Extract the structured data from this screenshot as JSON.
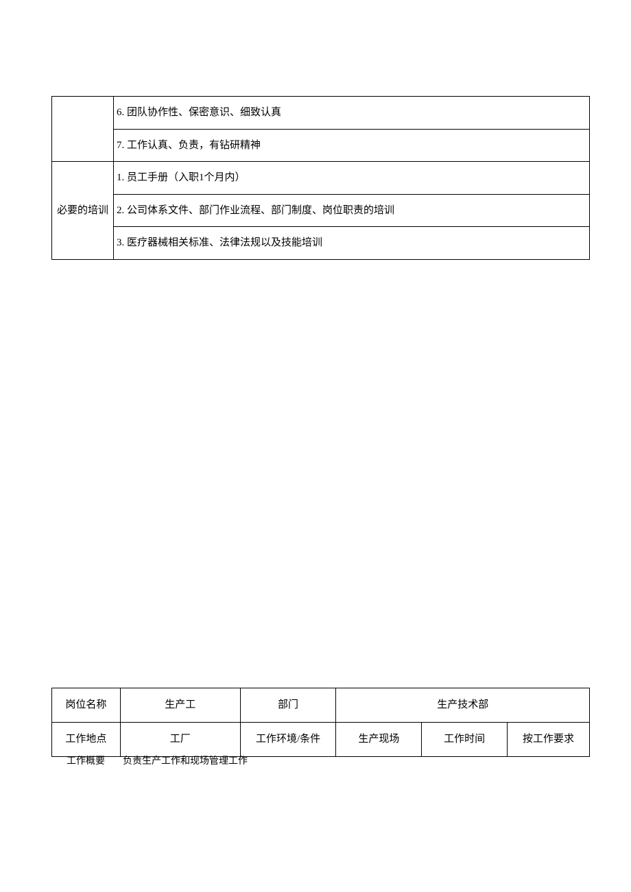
{
  "table1": {
    "section1_row1": "6. 团队协作性、保密意识、细致认真",
    "section1_row2": "7. 工作认真、负责，有钻研精神",
    "section2_label": "必要的培训",
    "section2_row1": "1. 员工手册（入职1个月内）",
    "section2_row2": "2. 公司体系文件、部门作业流程、部门制度、岗位职责的培训",
    "section2_row3": "3. 医疗器械相关标准、法律法规以及技能培训"
  },
  "table2": {
    "row1": {
      "label": "岗位名称",
      "value1": "生产工",
      "label2": "部门",
      "value2": "生产技术部"
    },
    "row2": {
      "label": "工作地点",
      "value1": "工厂",
      "label2": "工作环境/条件",
      "value2": "生产现场",
      "label3": "工作时间",
      "value3": "按工作要求"
    }
  },
  "summary": {
    "label": "工作概要",
    "value": "负责生产工作和现场管理工作"
  }
}
